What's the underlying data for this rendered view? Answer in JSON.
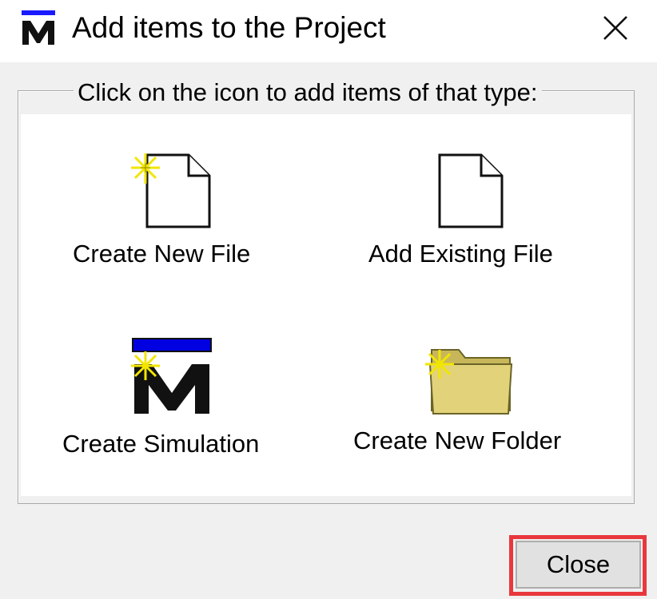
{
  "window": {
    "title": "Add items to the Project",
    "app_icon": "m-logo-icon",
    "close_icon": "close-icon"
  },
  "group": {
    "legend": "Click on the icon to add items of that type:"
  },
  "items": [
    {
      "label": "Create New File",
      "icon": "new-file-icon"
    },
    {
      "label": "Add Existing File",
      "icon": "file-icon"
    },
    {
      "label": "Create Simulation",
      "icon": "new-simulation-icon"
    },
    {
      "label": "Create New Folder",
      "icon": "new-folder-icon"
    }
  ],
  "footer": {
    "close_label": "Close"
  },
  "colors": {
    "logo_bar": "#0000e0",
    "sparkle": "#f2e600",
    "folder": "#e2d27a",
    "highlight": "#e8383d"
  }
}
